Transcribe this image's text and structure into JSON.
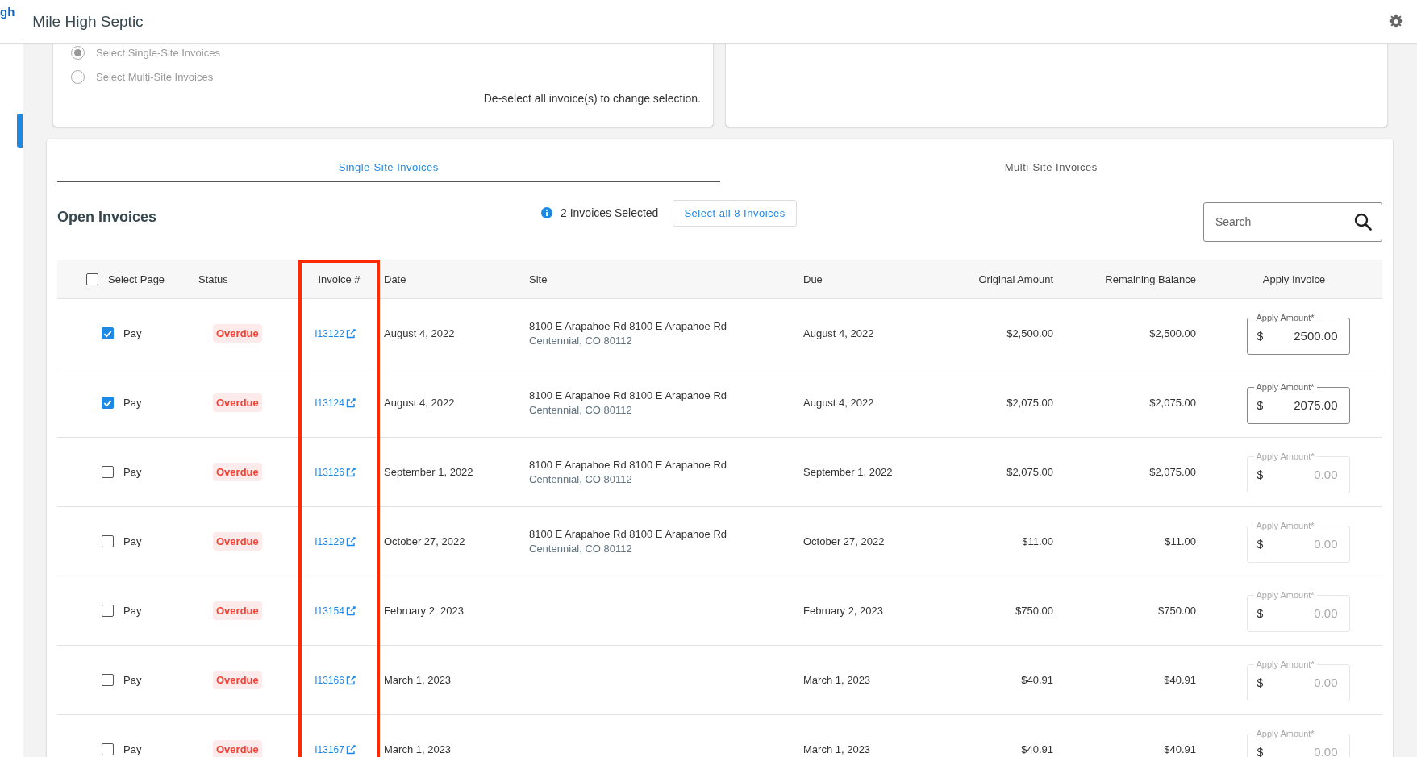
{
  "app_bar": {
    "logo_fragment": "gh",
    "title": "Mile High Septic"
  },
  "selection_card": {
    "radios": [
      {
        "label": "Select Single-Site Invoices",
        "selected": true,
        "disabled": true
      },
      {
        "label": "Select Multi-Site Invoices",
        "selected": false,
        "disabled": true
      }
    ],
    "note": "De-select all invoice(s) to change selection."
  },
  "tabs": [
    {
      "label": "Single-Site Invoices",
      "selected": true
    },
    {
      "label": "Multi-Site Invoices",
      "selected": false
    }
  ],
  "open_invoices": {
    "title": "Open Invoices",
    "selected_count": "2 Invoices Selected",
    "select_all_button": "Select all 8 Invoices",
    "search": {
      "placeholder": "Search"
    }
  },
  "table": {
    "columns": [
      {
        "label": "Select Page",
        "highlighted": false
      },
      {
        "label": "Status",
        "highlighted": false
      },
      {
        "label": "Invoice #",
        "highlighted": true
      },
      {
        "label": "Date",
        "highlighted": false
      },
      {
        "label": "Site",
        "highlighted": false
      },
      {
        "label": "Due",
        "highlighted": false
      },
      {
        "label": "Original Amount",
        "highlighted": false
      },
      {
        "label": "Remaining Balance",
        "highlighted": false
      },
      {
        "label": "Apply Invoice",
        "highlighted": false
      }
    ],
    "select_page_checked": false,
    "rows": [
      {
        "checked": true,
        "pay": "Pay",
        "status": {
          "label": "Overdue",
          "kind": "overdue"
        },
        "invoice": "I13122",
        "date": "August 4, 2022",
        "site": [
          "8100 E Arapahoe Rd 8100 E Arapahoe Rd",
          "Centennial, CO 80112"
        ],
        "due": "August 4, 2022",
        "original": "$2,500.00",
        "remaining": "$2,500.00",
        "apply": {
          "label": "Apply Amount*",
          "currency": "$",
          "value": "2500.00",
          "disabled": false
        }
      },
      {
        "checked": true,
        "pay": "Pay",
        "status": {
          "label": "Overdue",
          "kind": "overdue"
        },
        "invoice": "I13124",
        "date": "August 4, 2022",
        "site": [
          "8100 E Arapahoe Rd 8100 E Arapahoe Rd",
          "Centennial, CO 80112"
        ],
        "due": "August 4, 2022",
        "original": "$2,075.00",
        "remaining": "$2,075.00",
        "apply": {
          "label": "Apply Amount*",
          "currency": "$",
          "value": "2075.00",
          "disabled": false
        }
      },
      {
        "checked": false,
        "pay": "Pay",
        "status": {
          "label": "Overdue",
          "kind": "overdue"
        },
        "invoice": "I13126",
        "date": "September 1, 2022",
        "site": [
          "8100 E Arapahoe Rd 8100 E Arapahoe Rd",
          "Centennial, CO 80112"
        ],
        "due": "September 1, 2022",
        "original": "$2,075.00",
        "remaining": "$2,075.00",
        "apply": {
          "label": "Apply Amount*",
          "currency": "$",
          "value": "0.00",
          "disabled": true
        }
      },
      {
        "checked": false,
        "pay": "Pay",
        "status": {
          "label": "Overdue",
          "kind": "overdue"
        },
        "invoice": "I13129",
        "date": "October 27, 2022",
        "site": [
          "8100 E Arapahoe Rd 8100 E Arapahoe Rd",
          "Centennial, CO 80112"
        ],
        "due": "October 27, 2022",
        "original": "$11.00",
        "remaining": "$11.00",
        "apply": {
          "label": "Apply Amount*",
          "currency": "$",
          "value": "0.00",
          "disabled": true
        }
      },
      {
        "checked": false,
        "pay": "Pay",
        "status": {
          "label": "Overdue",
          "kind": "overdue"
        },
        "invoice": "I13154",
        "date": "February 2, 2023",
        "due": "February 2, 2023",
        "original": "$750.00",
        "remaining": "$750.00",
        "apply": {
          "label": "Apply Amount*",
          "currency": "$",
          "value": "0.00",
          "disabled": true
        }
      },
      {
        "checked": false,
        "pay": "Pay",
        "status": {
          "label": "Overdue",
          "kind": "overdue"
        },
        "invoice": "I13166",
        "date": "March 1, 2023",
        "due": "March 1, 2023",
        "original": "$40.91",
        "remaining": "$40.91",
        "apply": {
          "label": "Apply Amount*",
          "currency": "$",
          "value": "0.00",
          "disabled": true
        }
      },
      {
        "checked": false,
        "pay": "Pay",
        "status": {
          "label": "Overdue",
          "kind": "overdue"
        },
        "invoice": "I13167",
        "date": "March 1, 2023",
        "due": "March 1, 2023",
        "original": "$40.91",
        "remaining": "$40.91",
        "apply": {
          "label": "Apply Amount*",
          "currency": "$",
          "value": "0.00",
          "disabled": true
        }
      }
    ]
  }
}
